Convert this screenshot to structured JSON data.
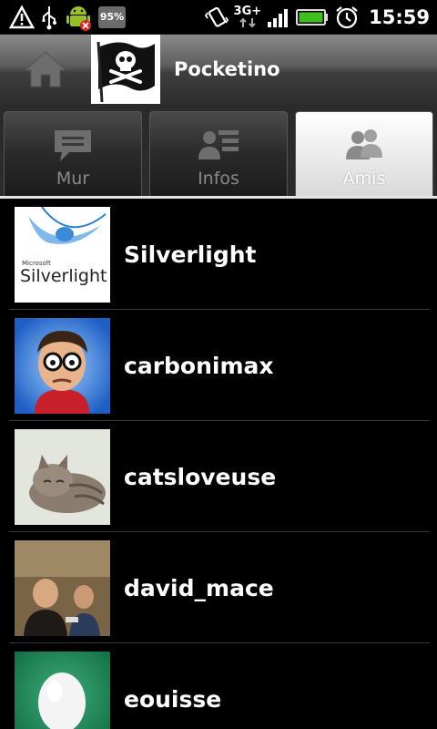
{
  "status_bar": {
    "battery_badge": "95%",
    "network_type": "3G+",
    "time": "15:59",
    "icons": [
      "warning-icon",
      "usb-icon",
      "android-debug-icon",
      "battery-badge-icon",
      "vibrate-icon",
      "network-arrows-icon",
      "signal-icon",
      "battery-icon",
      "alarm-icon"
    ]
  },
  "title_bar": {
    "app_title": "Pocketino",
    "home_icon": "home-icon",
    "profile_image": "pirate-flag"
  },
  "tabs": [
    {
      "label": "Mur",
      "icon": "speech-bubble-icon",
      "active": false
    },
    {
      "label": "Infos",
      "icon": "profile-card-icon",
      "active": false
    },
    {
      "label": "Amis",
      "icon": "friends-icon",
      "active": true
    }
  ],
  "friends": [
    {
      "name": "Silverlight",
      "avatar": "silverlight-logo",
      "avatar_text": "Silverlight",
      "avatar_small_text": "Microsoft"
    },
    {
      "name": "carbonimax",
      "avatar": "cartoon-man"
    },
    {
      "name": "catsloveuse",
      "avatar": "sleeping-kitten"
    },
    {
      "name": "david_mace",
      "avatar": "photo-people"
    },
    {
      "name": "eouisse",
      "avatar": "egg"
    }
  ],
  "colors": {
    "background": "#000000",
    "title_bar": "#4a4a4a",
    "tab_active": "#e6e6e6",
    "battery_green": "#3fbf1f",
    "divider": "#3a3a3a"
  }
}
